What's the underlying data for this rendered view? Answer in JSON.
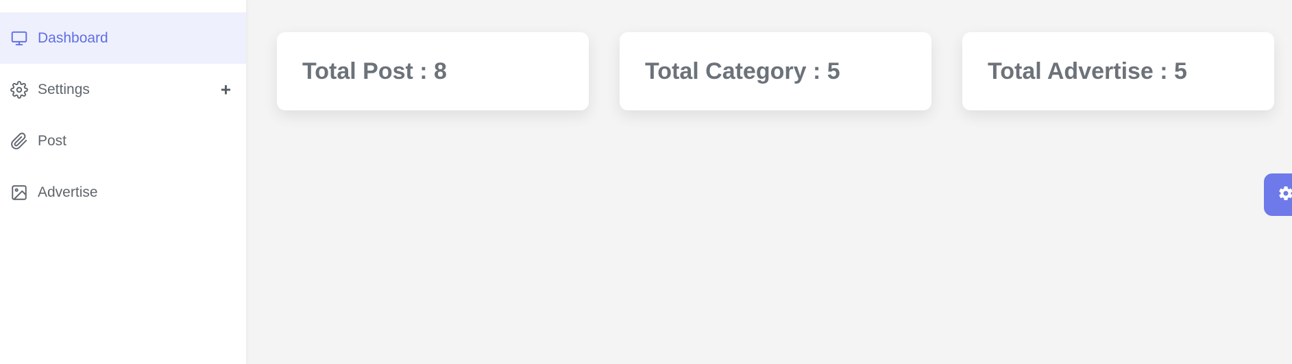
{
  "sidebar": {
    "items": [
      {
        "label": "Dashboard",
        "icon": "monitor-icon",
        "active": true
      },
      {
        "label": "Settings",
        "icon": "gear-icon",
        "expand": "+"
      },
      {
        "label": "Post",
        "icon": "paperclip-icon"
      },
      {
        "label": "Advertise",
        "icon": "image-icon"
      }
    ]
  },
  "cards": [
    {
      "label": "Total Post : 8"
    },
    {
      "label": "Total Category : 5"
    },
    {
      "label": "Total Advertise : 5"
    }
  ],
  "settings_fab": {
    "icon": "gear-icon"
  },
  "colors": {
    "accent": "#5f6ee3",
    "active_bg": "#eef0fd",
    "fab_bg": "#6e7ae9",
    "page_bg": "#f4f4f4",
    "text": "#6c727a"
  }
}
